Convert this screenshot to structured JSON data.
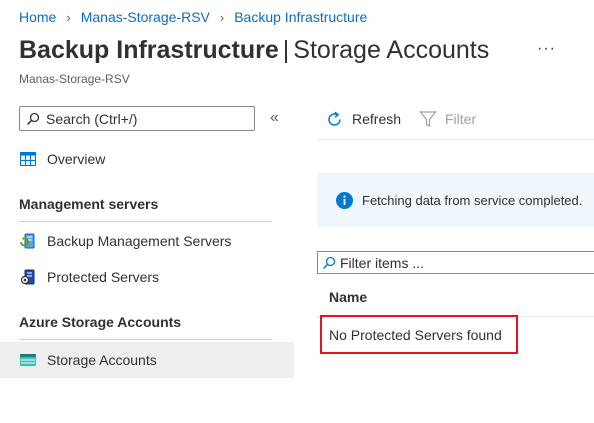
{
  "breadcrumb": [
    "Home",
    "Manas-Storage-RSV",
    "Backup Infrastructure"
  ],
  "header": {
    "title_main": "Backup Infrastructure",
    "title_separator": "|",
    "title_section": "Storage Accounts",
    "subtitle": "Manas-Storage-RSV",
    "more": "···"
  },
  "sidebar": {
    "search_placeholder": "Search (Ctrl+/)",
    "collapse": "«",
    "overview": "Overview",
    "group_management": "Management servers",
    "backup_management_servers": "Backup Management Servers",
    "protected_servers": "Protected Servers",
    "group_azure_storage": "Azure Storage Accounts",
    "storage_accounts": "Storage Accounts"
  },
  "toolbar": {
    "refresh": "Refresh",
    "filter": "Filter"
  },
  "info": {
    "message": "Fetching data from service completed."
  },
  "grid": {
    "filter_placeholder": "Filter items ...",
    "column_name": "Name",
    "empty_message": "No Protected Servers found"
  },
  "colors": {
    "link": "#0f6cbd",
    "selected_bg": "#eeeeee",
    "info_bg": "#eff6fc",
    "highlight_border": "#e81123"
  }
}
